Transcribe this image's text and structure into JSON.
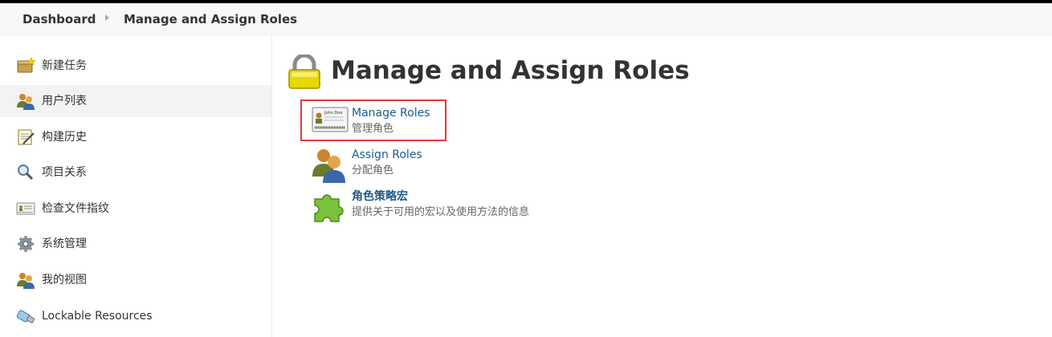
{
  "breadcrumb": {
    "items": [
      {
        "label": "Dashboard"
      },
      {
        "label": "Manage and Assign Roles"
      }
    ]
  },
  "sidebar": {
    "items": [
      {
        "label": "新建任务",
        "icon": "new-item-icon"
      },
      {
        "label": "用户列表",
        "icon": "users-icon",
        "active": true
      },
      {
        "label": "构建历史",
        "icon": "notepad-icon"
      },
      {
        "label": "项目关系",
        "icon": "magnifier-icon"
      },
      {
        "label": "检查文件指纹",
        "icon": "fingerprint-card-icon"
      },
      {
        "label": "系统管理",
        "icon": "gear-icon"
      },
      {
        "label": "我的视图",
        "icon": "users-icon"
      },
      {
        "label": "Lockable Resources",
        "icon": "usb-lock-icon"
      }
    ]
  },
  "main": {
    "title": "Manage and Assign Roles",
    "title_icon": "lock-icon",
    "entries": [
      {
        "title": "Manage Roles",
        "description": "管理角色",
        "icon": "id-card-icon",
        "card_name": "John Doe"
      },
      {
        "title": "Assign Roles",
        "description": "分配角色",
        "icon": "assign-users-icon"
      },
      {
        "title": "角色策略宏",
        "description": "提供关于可用的宏以及使用方法的信息",
        "icon": "puzzle-icon"
      }
    ]
  },
  "colors": {
    "link": "#1d5a86",
    "highlight_border": "#e53935",
    "active_item_bg": "#f3f3f3",
    "lock_yellow": "#e6d800",
    "puzzle_green": "#7cc13b"
  }
}
